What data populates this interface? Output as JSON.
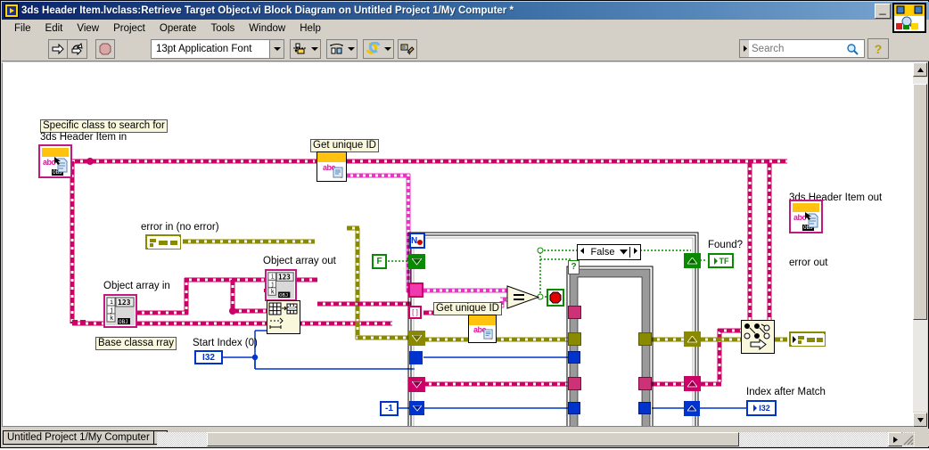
{
  "window": {
    "title": "3ds Header Item.lvclass:Retrieve Target Object.vi Block Diagram on Untitled Project 1/My Computer *",
    "app_icon": "labview-vi-icon",
    "minimize_glyph": "_",
    "maximize_glyph": "□",
    "close_glyph": "✕"
  },
  "menu": {
    "items": [
      {
        "label": "File"
      },
      {
        "label": "Edit"
      },
      {
        "label": "View"
      },
      {
        "label": "Project"
      },
      {
        "label": "Operate"
      },
      {
        "label": "Tools"
      },
      {
        "label": "Window"
      },
      {
        "label": "Help"
      }
    ]
  },
  "toolbar": {
    "run_label": "run-arrow-icon",
    "run_continuous_label": "run-continuously-icon",
    "abort_label": "abort-execution-icon",
    "font_value": "13pt Application Font",
    "align_label": "align-objects-icon",
    "distribute_label": "distribute-objects-icon",
    "reorder_label": "reorder-icon",
    "cleanup_label": "clean-up-diagram-icon",
    "search_placeholder": "Search",
    "search_value": "",
    "help_label": "?",
    "palette_label": "context-help-palette-icon"
  },
  "statusbar": {
    "context": "Untitled Project 1/My Computer"
  },
  "diagram": {
    "labels": {
      "specific_class": "Specific class to search for",
      "header_item_in": "3ds Header Item in",
      "error_in": "error in (no error)",
      "object_array_in": "Object array in",
      "base_class_array": "Base classa rray",
      "start_index": "Start Index (0)",
      "get_unique_id_outer": "Get unique ID",
      "object_array_out": "Object array out",
      "get_unique_id_inner": "Get unique ID",
      "false_case": "False",
      "found": "Found?",
      "header_item_out": "3ds Header Item out",
      "error_out": "error out",
      "index_after_match": "Index after Match"
    },
    "constants": {
      "false_const": "F",
      "minus_one": "-1",
      "iteration": "i",
      "count_terminal": "N"
    },
    "indicators": {
      "found_type": "TF",
      "index_type": "I32",
      "start_index_type": "I32"
    },
    "nodes": {
      "equals": "=",
      "stop": "stop-sign-icon",
      "array_subset": "array-subset-icon",
      "merge_errors": "merge-errors-icon",
      "case_selector": "?"
    },
    "colors": {
      "object_wire": "#cc0066",
      "error_wire": "#8a8a00",
      "boolean_wire": "#0a8a00",
      "numeric_wire": "#0033cc",
      "refnum_wire": "#e637c4",
      "object_border": "#c0197f",
      "subvi_header": "#ffc20e",
      "canvas": "#ffffff"
    }
  }
}
